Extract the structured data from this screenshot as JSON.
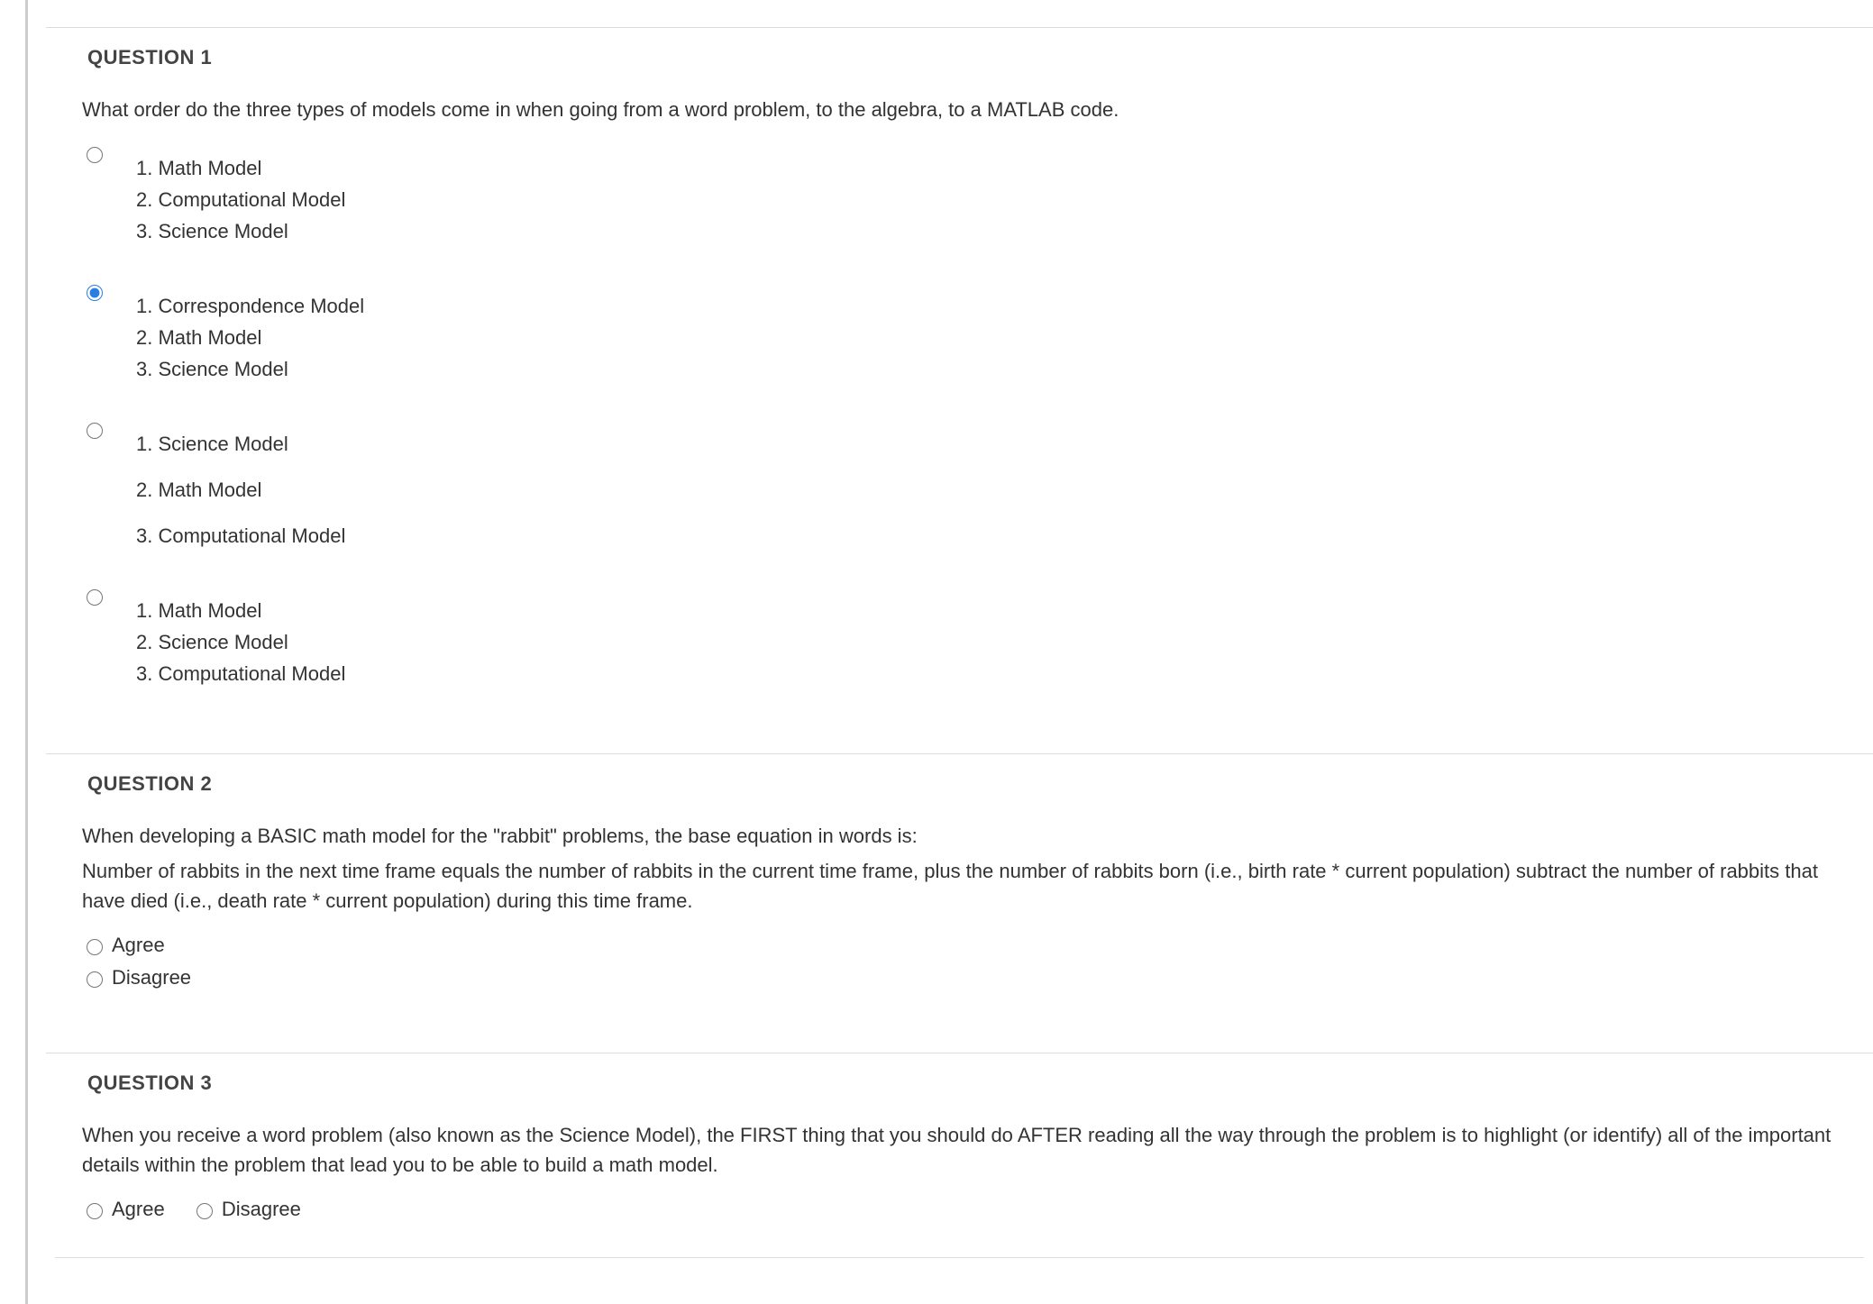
{
  "q1": {
    "title": "QUESTION 1",
    "prompt": "What order do the three types of models come in when going from a word problem, to the algebra, to a MATLAB code.",
    "options": [
      {
        "selected": false,
        "lines": [
          "1. Math Model",
          "2. Computational Model",
          "3. Science Model"
        ]
      },
      {
        "selected": true,
        "lines": [
          "1. Correspondence Model",
          "2. Math Model",
          "3. Science Model"
        ]
      },
      {
        "selected": false,
        "lines": [
          "1. Science Model",
          "2. Math Model",
          "3. Computational Model"
        ],
        "spacedLines": true
      },
      {
        "selected": false,
        "lines": [
          "1. Math Model",
          "2. Science Model",
          "3. Computational Model"
        ]
      }
    ]
  },
  "q2": {
    "title": "QUESTION 2",
    "prompt_line1": "When developing a BASIC math model for the \"rabbit\" problems, the base equation in words is:",
    "prompt_line2": "Number of rabbits in the next time frame equals the number of rabbits in the current time frame, plus the number of rabbits born (i.e., birth rate * current population) subtract the number of rabbits that have died (i.e., death rate * current population) during this time frame.",
    "options": [
      {
        "label": "Agree"
      },
      {
        "label": "Disagree"
      }
    ]
  },
  "q3": {
    "title": "QUESTION 3",
    "prompt": "When you receive a word problem (also known as the Science Model), the FIRST thing that you should do AFTER reading all the way through the problem is to highlight (or identify) all of the important details within the problem that lead you to be able to build a math model.",
    "options": [
      {
        "label": "Agree"
      },
      {
        "label": "Disagree"
      }
    ]
  }
}
